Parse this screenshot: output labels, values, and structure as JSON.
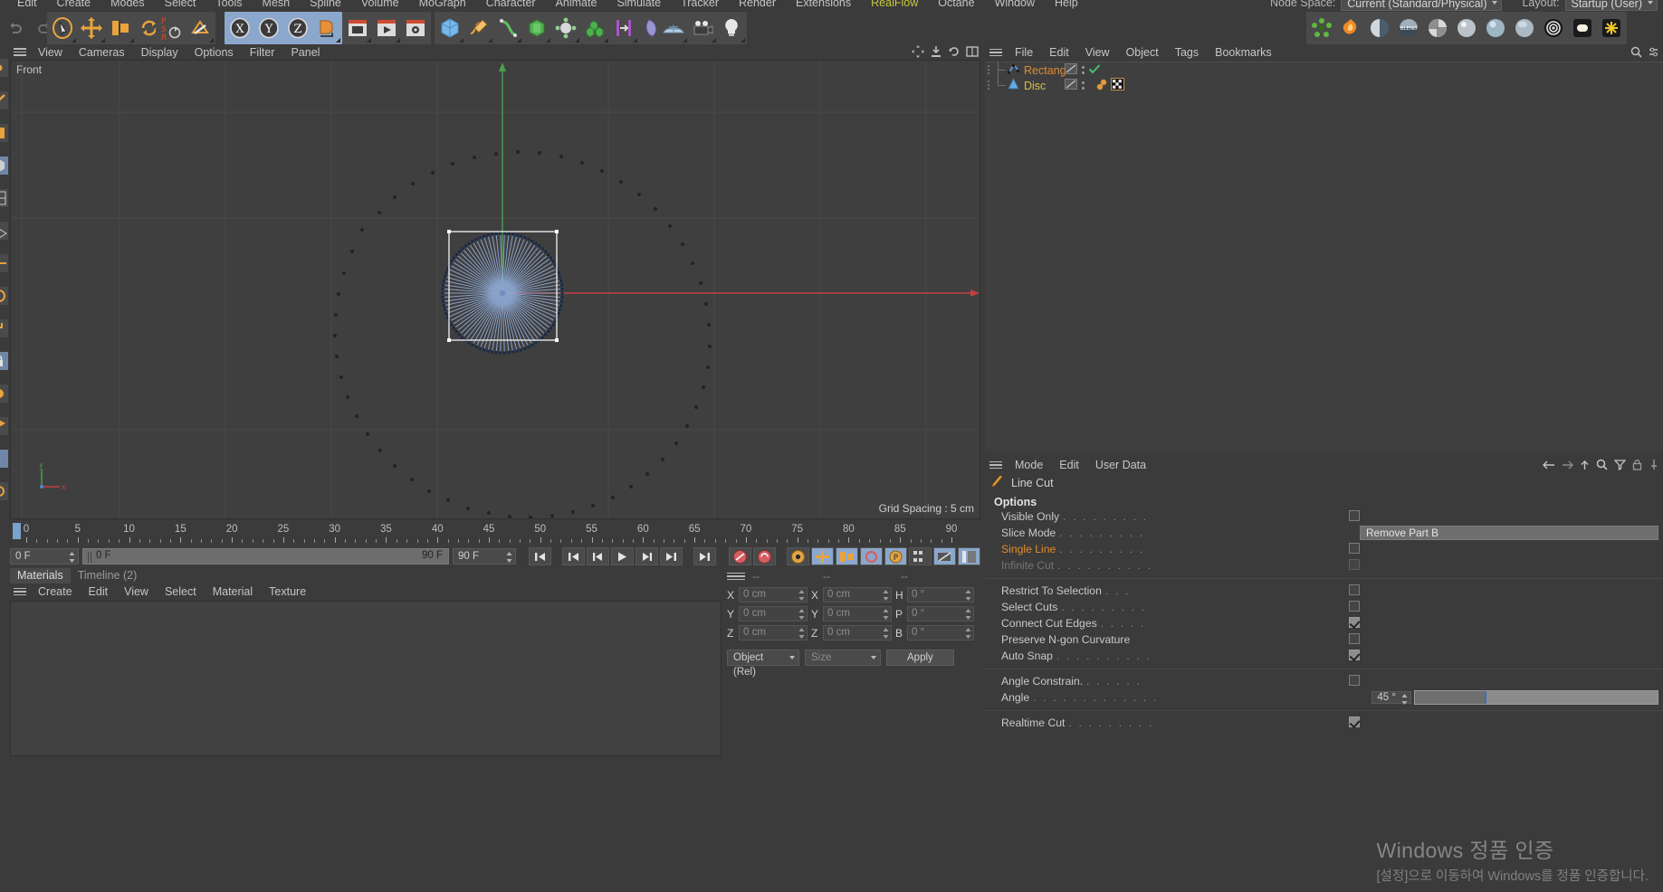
{
  "app": {
    "main_menu": [
      "Edit",
      "Create",
      "Modes",
      "Select",
      "Tools",
      "Mesh",
      "Spline",
      "Volume",
      "MoGraph",
      "Character",
      "Animate",
      "Simulate",
      "Tracker",
      "Render",
      "Extensions",
      "RealFlow",
      "Octane",
      "Window",
      "Help"
    ],
    "highlight_menu": "RealFlow",
    "node_space_label": "Node Space:",
    "node_space_value": "Current (Standard/Physical)",
    "layout_label": "Layout:",
    "layout_value": "Startup (User)"
  },
  "toolbar": {
    "groups": [
      {
        "name": "undo-redo",
        "icons": [
          "undo-icon",
          "redo-icon"
        ]
      },
      {
        "name": "selection",
        "icons": [
          "live-selection-icon",
          "move-icon",
          "scale-icon",
          "rotate-icon"
        ]
      },
      {
        "name": "psr",
        "icons": [
          "psr-toggle-icon",
          "workplane-icon"
        ]
      },
      {
        "name": "axis-lock",
        "icons": [
          "lock-x-icon",
          "lock-y-icon",
          "lock-z-icon",
          "world-coordinate-icon"
        ]
      },
      {
        "name": "render",
        "icons": [
          "render-view-icon",
          "render-queue-icon",
          "render-settings-icon"
        ]
      },
      {
        "name": "objects",
        "icons": [
          "cube-icon",
          "spline-pen-icon",
          "nurbs-icon",
          "array-icon",
          "mograph-icon",
          "cloner-icon",
          "deformer-icon",
          "field-icon"
        ]
      },
      {
        "name": "scene",
        "icons": [
          "floor-icon",
          "camera-icon",
          "light-icon"
        ]
      },
      {
        "name": "materials",
        "icons": [
          "node-material-icon",
          "explosion-material-icon",
          "shiny-material-icon",
          "blend-material-icon",
          "checker-material-icon",
          "glossy-material-icon",
          "water-material-icon",
          "pearl-material-icon",
          "target-material-icon",
          "emissive-material-icon",
          "sparkle-material-icon"
        ]
      }
    ]
  },
  "viewport": {
    "menu": [
      "View",
      "Cameras",
      "Display",
      "Options",
      "Filter",
      "Panel"
    ],
    "view_label": "Front",
    "grid_spacing": "Grid Spacing : 5 cm",
    "axis_x_label": "x",
    "axis_y_label": "y"
  },
  "timeline": {
    "ticks": [
      0,
      5,
      10,
      15,
      20,
      25,
      30,
      35,
      40,
      45,
      50,
      55,
      60,
      65,
      70,
      75,
      80,
      85,
      90
    ],
    "current_frame": "0 F",
    "range_start": "0 F",
    "range_end": "90 F",
    "end_frame": "90 F",
    "preview_end": "90 F",
    "transport": [
      "go-to-start-icon",
      "step-back-icon",
      "play-icon",
      "step-forward-icon",
      "go-to-end-icon",
      "go-to-last-icon"
    ],
    "record_tools": [
      "record-keyframe-icon",
      "autokey-icon",
      "keyframe-settings-icon",
      "position-key-icon",
      "scale-key-icon",
      "rotation-key-icon",
      "param-key-icon",
      "point-level-key-icon",
      "mute-key-icon",
      "timeline-toggle-icon"
    ]
  },
  "materials_panel": {
    "tabs": [
      {
        "label": "Materials",
        "active": true
      },
      {
        "label": "Timeline (2)",
        "active": false
      }
    ],
    "menu": [
      "Create",
      "Edit",
      "View",
      "Select",
      "Material",
      "Texture"
    ]
  },
  "coordinates_panel": {
    "header_left": "--",
    "header_mid": "--",
    "header_right": "--",
    "rows": [
      {
        "axis": "X",
        "pos": "0 cm",
        "size": "0 cm",
        "rot_label": "H",
        "rot": "0 °"
      },
      {
        "axis": "Y",
        "pos": "0 cm",
        "size": "0 cm",
        "rot_label": "P",
        "rot": "0 °"
      },
      {
        "axis": "Z",
        "pos": "0 cm",
        "size": "0 cm",
        "rot_label": "B",
        "rot": "0 °"
      }
    ],
    "mode_value": "Object (Rel)",
    "size_value": "Size",
    "apply_label": "Apply"
  },
  "object_manager": {
    "menu": [
      "File",
      "Edit",
      "View",
      "Object",
      "Tags",
      "Bookmarks"
    ],
    "right_icons": [
      "search-icon",
      "options-icon"
    ],
    "objects": [
      {
        "name": "Rectangle",
        "icon": "spline-icon",
        "selected": true,
        "tags": [
          "display-tag",
          "visibility-dots",
          "green-check-tag"
        ]
      },
      {
        "name": "Disc",
        "icon": "disc-cone-icon",
        "selected": false,
        "tags": [
          "display-tag",
          "visibility-dots",
          "material-tag",
          "checker-texture-tag"
        ]
      }
    ]
  },
  "attribute_manager": {
    "menu": [
      "Mode",
      "Edit",
      "User Data"
    ],
    "right_icons": [
      "back-arrow-icon",
      "forward-arrow-icon",
      "up-arrow-icon",
      "search-icon",
      "filter-icon",
      "lock-icon",
      "pin-icon"
    ],
    "tool_title": "Line Cut",
    "tool_icon": "line-cut-icon",
    "section_title": "Options",
    "options": [
      {
        "label": "Visible Only",
        "leader": ". . . . . . . . .",
        "type": "checkbox",
        "checked": false,
        "style": "normal"
      },
      {
        "label": "Slice Mode",
        "leader": ". . . . . . . . .",
        "type": "combo",
        "value": "Remove Part B",
        "style": "normal"
      },
      {
        "label": "Single Line",
        "leader": ". . . . . . . . .",
        "type": "checkbox",
        "checked": false,
        "style": "orange"
      },
      {
        "label": "Infinite Cut",
        "leader": ". . . . . . . . . .",
        "type": "checkbox",
        "checked": false,
        "style": "dim"
      },
      {
        "label": "Restrict To Selection",
        "leader": ". . .",
        "type": "checkbox",
        "checked": false,
        "style": "normal",
        "gap_above": true
      },
      {
        "label": "Select Cuts",
        "leader": ". . . . . . . . .",
        "type": "checkbox",
        "checked": false,
        "style": "normal"
      },
      {
        "label": "Connect Cut Edges",
        "leader": ". . . . .",
        "type": "checkbox",
        "checked": true,
        "style": "normal"
      },
      {
        "label": "Preserve N-gon Curvature",
        "leader": "",
        "type": "checkbox",
        "checked": false,
        "style": "normal"
      },
      {
        "label": "Auto Snap",
        "leader": ". . . . . . . . . .",
        "type": "checkbox",
        "checked": true,
        "style": "normal"
      },
      {
        "label": "Angle Constrain.",
        "leader": ". . . . . .",
        "type": "checkbox",
        "checked": false,
        "style": "normal",
        "gap_above": true
      },
      {
        "label": "Angle",
        "leader": ". . . . . . . . . . . . .",
        "type": "slider",
        "value": "45 °",
        "style": "normal"
      },
      {
        "label": "Realtime Cut",
        "leader": ". . . . . . . . .",
        "type": "checkbox",
        "checked": true,
        "style": "normal",
        "gap_above": true
      }
    ]
  },
  "watermark": {
    "title": "Windows 정품 인증",
    "subtitle": "[설정]으로 이동하여 Windows를 정품 인증합니다."
  },
  "colors": {
    "bg": "#3b3b3b",
    "panel": "#3f3f3f",
    "accent_orange": "#e08b32",
    "accent_yellow": "#d8c048",
    "highlight_blue": "#8ba7cc",
    "axis_x": "#c04040",
    "axis_y": "#49a049",
    "spline_blue": "#8ea8d2"
  }
}
